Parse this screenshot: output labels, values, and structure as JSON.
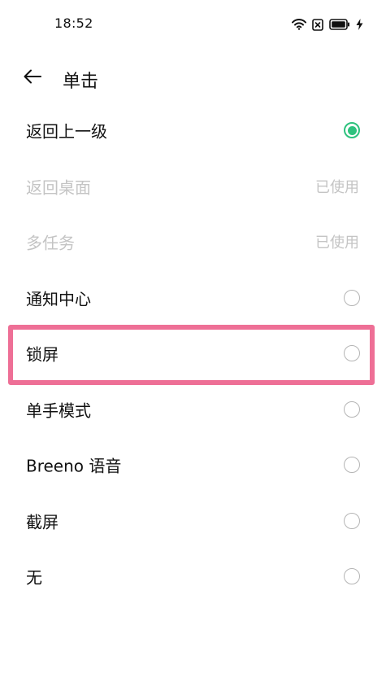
{
  "status_bar": {
    "time": "18:52",
    "icons": [
      "wifi-icon",
      "no-sim-icon",
      "battery-icon",
      "charging-icon"
    ]
  },
  "header": {
    "back_icon": "arrow-left-icon",
    "title": "单击"
  },
  "options": [
    {
      "label": "返回上一级",
      "state": "selected",
      "status": ""
    },
    {
      "label": "返回桌面",
      "state": "disabled",
      "status": "已使用"
    },
    {
      "label": "多任务",
      "state": "disabled",
      "status": "已使用"
    },
    {
      "label": "通知中心",
      "state": "unselected",
      "status": ""
    },
    {
      "label": "锁屏",
      "state": "unselected",
      "status": "",
      "highlighted": true
    },
    {
      "label": "单手模式",
      "state": "unselected",
      "status": ""
    },
    {
      "label": "Breeno 语音",
      "state": "unselected",
      "status": ""
    },
    {
      "label": "截屏",
      "state": "unselected",
      "status": ""
    },
    {
      "label": "无",
      "state": "unselected",
      "status": ""
    }
  ],
  "colors": {
    "accent": "#2ec27e",
    "highlight": "#ee6f96",
    "disabled_text": "#c4c4c4"
  }
}
